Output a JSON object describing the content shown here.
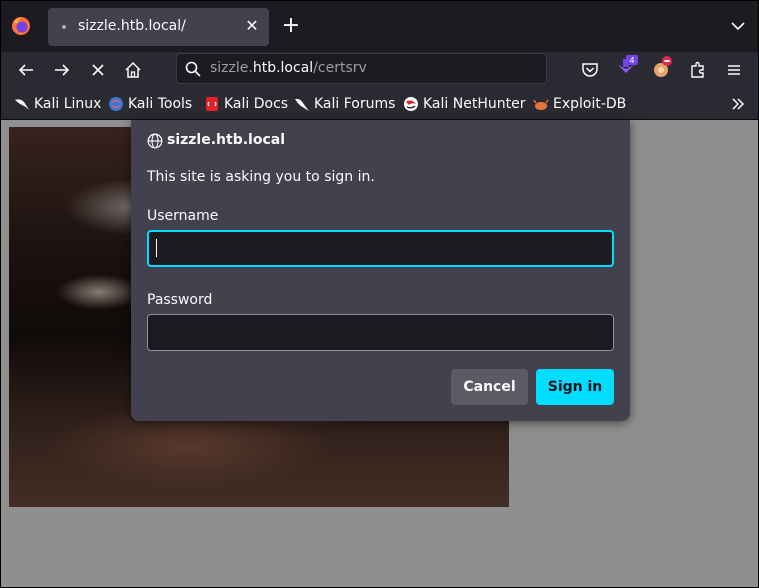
{
  "tab": {
    "title": "sizzle.htb.local/"
  },
  "urlbar": {
    "host": "sizzle.htb.local",
    "path": "/certsrv",
    "host_prefix": "sizzle.",
    "host_domain": "htb.local"
  },
  "toolbar": {
    "extension_badge": "4"
  },
  "bookmarks": [
    {
      "label": "Kali Linux",
      "icon": "kali-dragon-icon"
    },
    {
      "label": "Kali Tools",
      "icon": "kali-tools-icon"
    },
    {
      "label": "Kali Docs",
      "icon": "kali-docs-icon"
    },
    {
      "label": "Kali Forums",
      "icon": "kali-forums-icon"
    },
    {
      "label": "Kali NetHunter",
      "icon": "nethunter-icon"
    },
    {
      "label": "Exploit-DB",
      "icon": "exploit-db-icon"
    }
  ],
  "dialog": {
    "host": "sizzle.htb.local",
    "message": "This site is asking you to sign in.",
    "username_label": "Username",
    "username_value": "",
    "password_label": "Password",
    "password_value": "",
    "cancel_label": "Cancel",
    "signin_label": "Sign in"
  },
  "colors": {
    "accent": "#00ddff",
    "dialog_bg": "#42414d",
    "toolbar_bg": "#2b2a33"
  }
}
